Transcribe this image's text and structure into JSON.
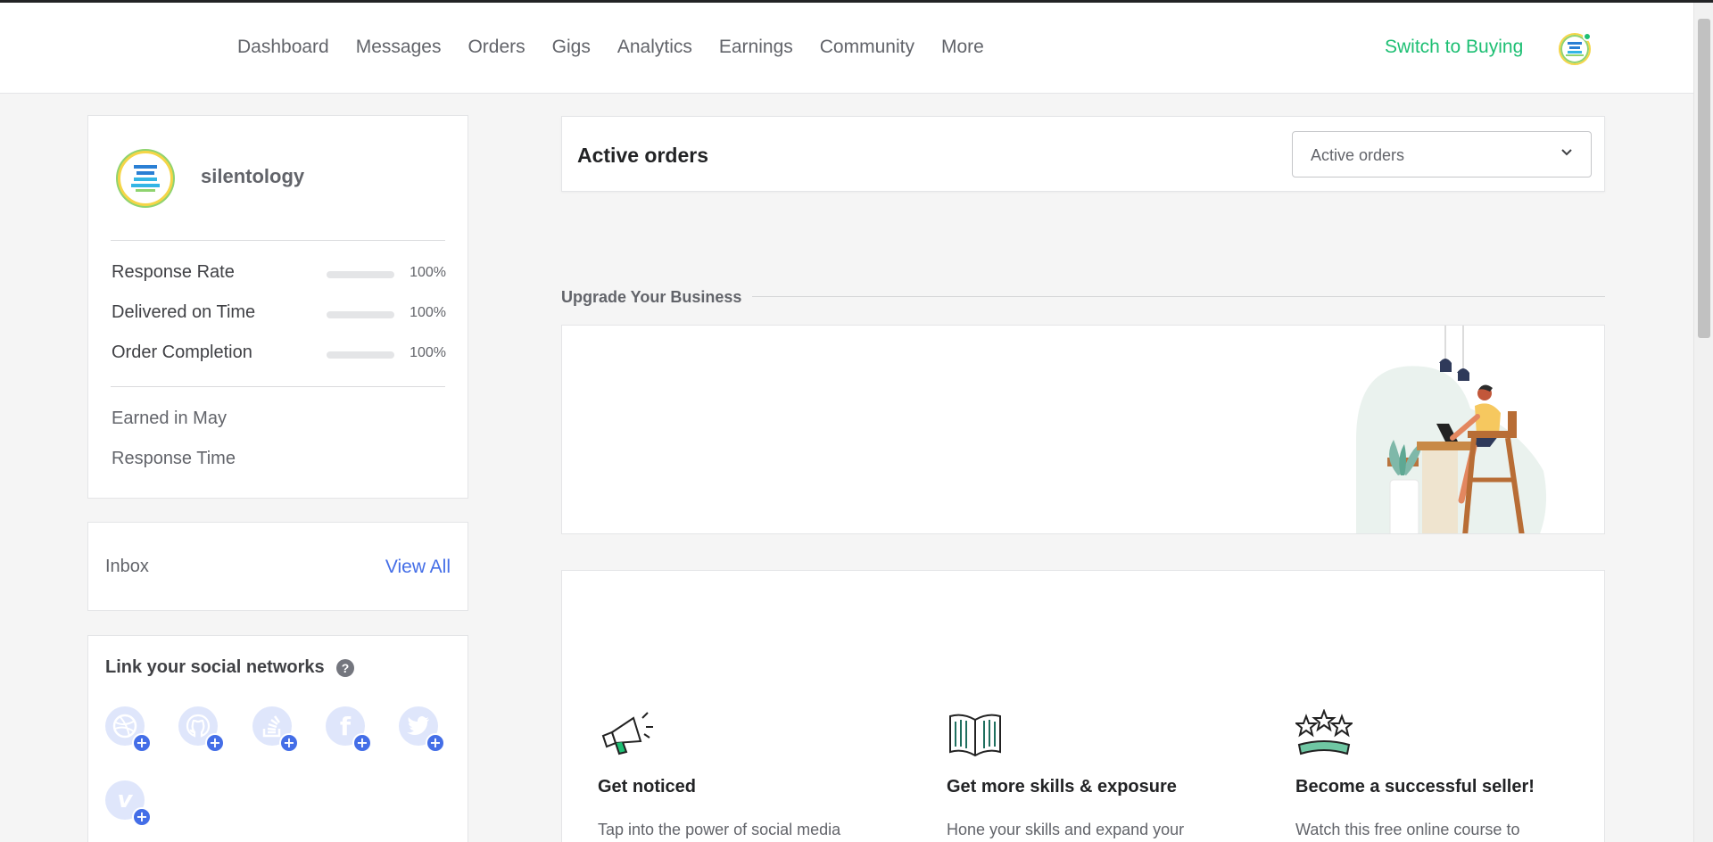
{
  "nav": {
    "items": [
      "Dashboard",
      "Messages",
      "Orders",
      "Gigs",
      "Analytics",
      "Earnings",
      "Community",
      "More"
    ],
    "switch_label": "Switch to Buying"
  },
  "profile": {
    "username": "silentology",
    "stats": [
      {
        "label": "Response Rate",
        "percent": 100,
        "value_text": "100%"
      },
      {
        "label": "Delivered on Time",
        "percent": 100,
        "value_text": "100%"
      },
      {
        "label": "Order Completion",
        "percent": 100,
        "value_text": "100%"
      }
    ],
    "earned_label": "Earned in May",
    "response_time_label": "Response Time"
  },
  "inbox": {
    "title": "Inbox",
    "view_all": "View All"
  },
  "social": {
    "title": "Link your social networks",
    "help": "?",
    "networks": [
      "dribbble-icon",
      "github-icon",
      "stackoverflow-icon",
      "facebook-icon",
      "twitter-icon",
      "vimeo-icon"
    ]
  },
  "orders": {
    "title": "Active orders",
    "selected": "Active orders"
  },
  "upgrade": {
    "title": "Upgrade Your Business"
  },
  "learn": {
    "cards": [
      {
        "icon": "megaphone-icon",
        "title": "Get noticed",
        "text": "Tap into the power of social media"
      },
      {
        "icon": "book-icon",
        "title": "Get more skills & exposure",
        "text": "Hone your skills and expand your"
      },
      {
        "icon": "stars-icon",
        "title": "Become a successful seller!",
        "text": "Watch this free online course to"
      }
    ]
  },
  "colors": {
    "accent_green": "#1dbf73",
    "link_blue": "#446ee7",
    "text_dark": "#404145"
  }
}
